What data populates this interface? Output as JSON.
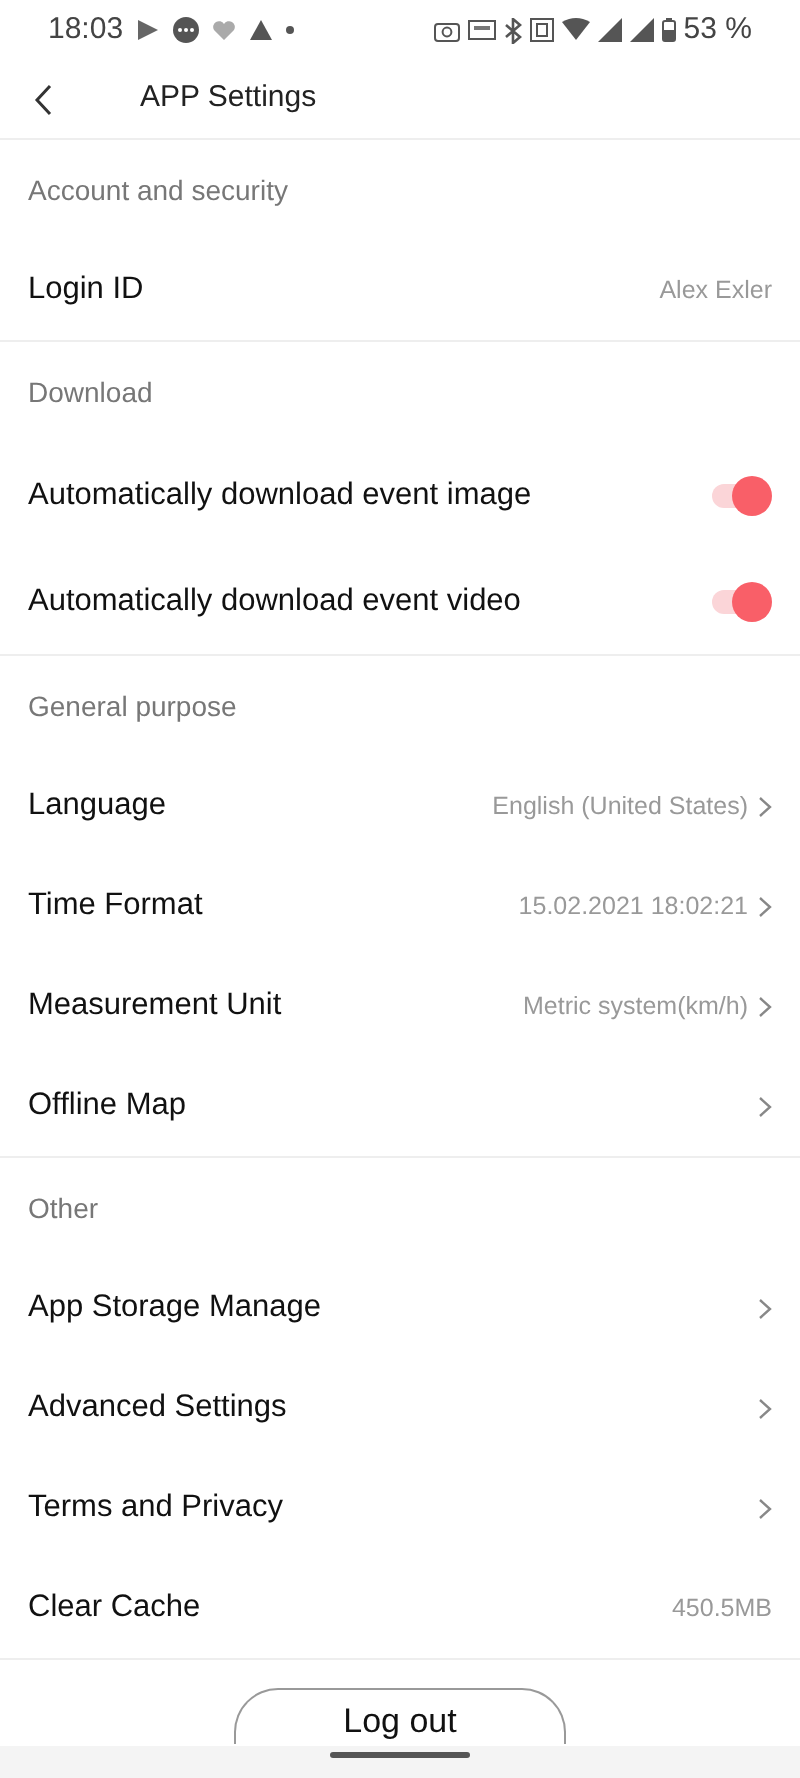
{
  "status_bar": {
    "time": "18:03",
    "battery": "53 %"
  },
  "header": {
    "title": "APP Settings"
  },
  "sections": [
    {
      "title": "Account and security",
      "items": [
        {
          "kind": "value",
          "label": "Login ID",
          "value": "Alex Exler"
        }
      ]
    },
    {
      "title": "Download",
      "items": [
        {
          "kind": "toggle",
          "label": "Automatically download event image",
          "on": true
        },
        {
          "kind": "toggle",
          "label": "Automatically download event video",
          "on": true
        }
      ]
    },
    {
      "title": "General purpose",
      "items": [
        {
          "kind": "link",
          "label": "Language",
          "value": "English (United States)"
        },
        {
          "kind": "link",
          "label": "Time Format",
          "value": "15.02.2021 18:02:21"
        },
        {
          "kind": "link",
          "label": "Measurement Unit",
          "value": "Metric system(km/h)"
        },
        {
          "kind": "link",
          "label": "Offline Map"
        }
      ]
    },
    {
      "title": "Other",
      "items": [
        {
          "kind": "link",
          "label": "App Storage Manage"
        },
        {
          "kind": "link",
          "label": "Advanced Settings"
        },
        {
          "kind": "link",
          "label": "Terms and Privacy"
        },
        {
          "kind": "value",
          "label": "Clear Cache",
          "value": "450.5MB"
        }
      ]
    }
  ],
  "logout_button": "Log out"
}
